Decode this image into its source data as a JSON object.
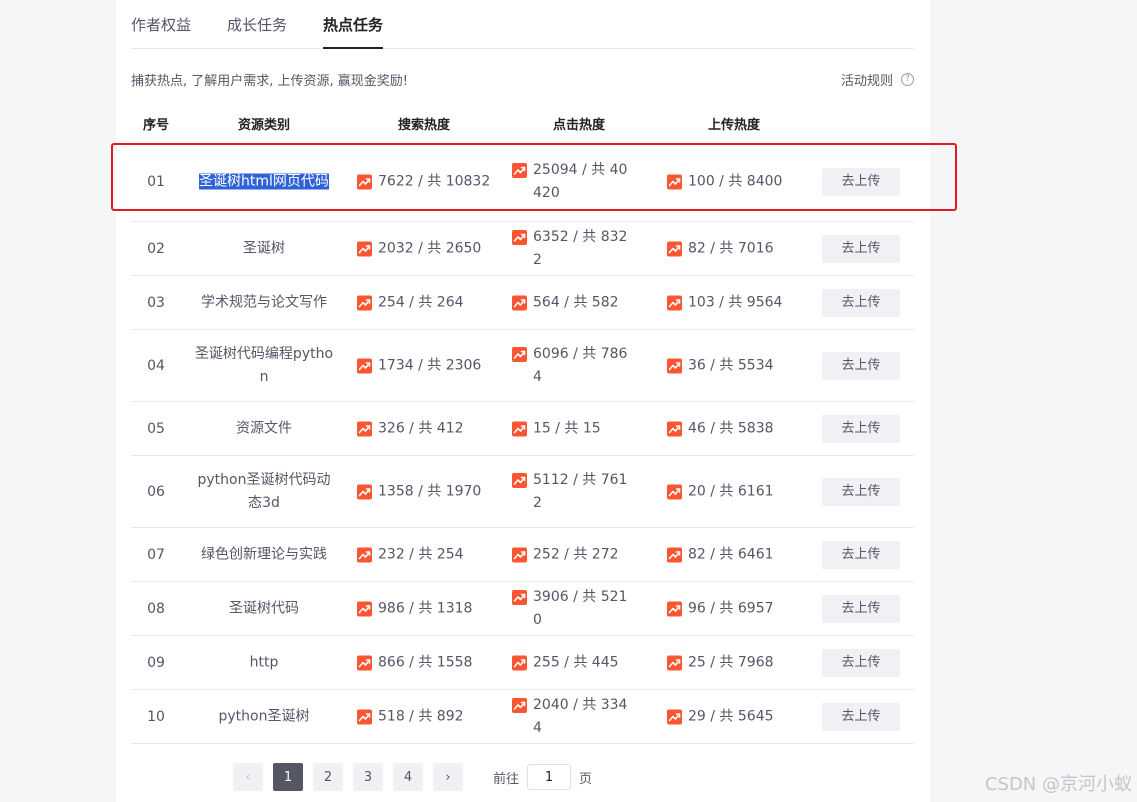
{
  "tabs": [
    {
      "label": "作者权益"
    },
    {
      "label": "成长任务"
    },
    {
      "label": "热点任务"
    }
  ],
  "description": "捕获热点, 了解用户需求, 上传资源, 赢现金奖励!",
  "rules_link": "活动规则",
  "help_glyph": "?",
  "columns": [
    "序号",
    "资源类别",
    "搜索热度",
    "点击热度",
    "上传热度"
  ],
  "upload_label": "去上传",
  "rows": [
    {
      "no": "01",
      "category": "圣诞树html网页代码",
      "search": "7622 / 共 10832",
      "click": "25094 / 共 40420",
      "upload": "100 / 共 8400"
    },
    {
      "no": "02",
      "category": "圣诞树",
      "search": "2032 / 共 2650",
      "click": "6352 / 共 8322",
      "upload": "82 / 共 7016"
    },
    {
      "no": "03",
      "category": "学术规范与论文写作",
      "search": "254 / 共 264",
      "click": "564 / 共 582",
      "upload": "103 / 共 9564"
    },
    {
      "no": "04",
      "category": "圣诞树代码编程python",
      "search": "1734 / 共 2306",
      "click": "6096 / 共 7864",
      "upload": "36 / 共 5534"
    },
    {
      "no": "05",
      "category": "资源文件",
      "search": "326 / 共 412",
      "click": "15 / 共 15",
      "upload": "46 / 共 5838"
    },
    {
      "no": "06",
      "category": "python圣诞树代码动态3d",
      "search": "1358 / 共 1970",
      "click": "5112 / 共 7612",
      "upload": "20 / 共 6161"
    },
    {
      "no": "07",
      "category": "绿色创新理论与实践",
      "search": "232 / 共 254",
      "click": "252 / 共 272",
      "upload": "82 / 共 6461"
    },
    {
      "no": "08",
      "category": "圣诞树代码",
      "search": "986 / 共 1318",
      "click": "3906 / 共 5210",
      "upload": "96 / 共 6957"
    },
    {
      "no": "09",
      "category": "http",
      "search": "866 / 共 1558",
      "click": "255 / 共 445",
      "upload": "25 / 共 7968"
    },
    {
      "no": "10",
      "category": "python圣诞树",
      "search": "518 / 共 892",
      "click": "2040 / 共 3344",
      "upload": "29 / 共 5645"
    }
  ],
  "pagination": {
    "prev": "‹",
    "next": "›",
    "pages": [
      "1",
      "2",
      "3",
      "4"
    ],
    "current": "1",
    "goto_prefix": "前往",
    "goto_value": "1",
    "goto_suffix": "页"
  },
  "watermark": "CSDN @京河小蚁",
  "colors": {
    "accent": "#fc5531",
    "frame": "#e3191e",
    "selection": "#2f62d6"
  }
}
